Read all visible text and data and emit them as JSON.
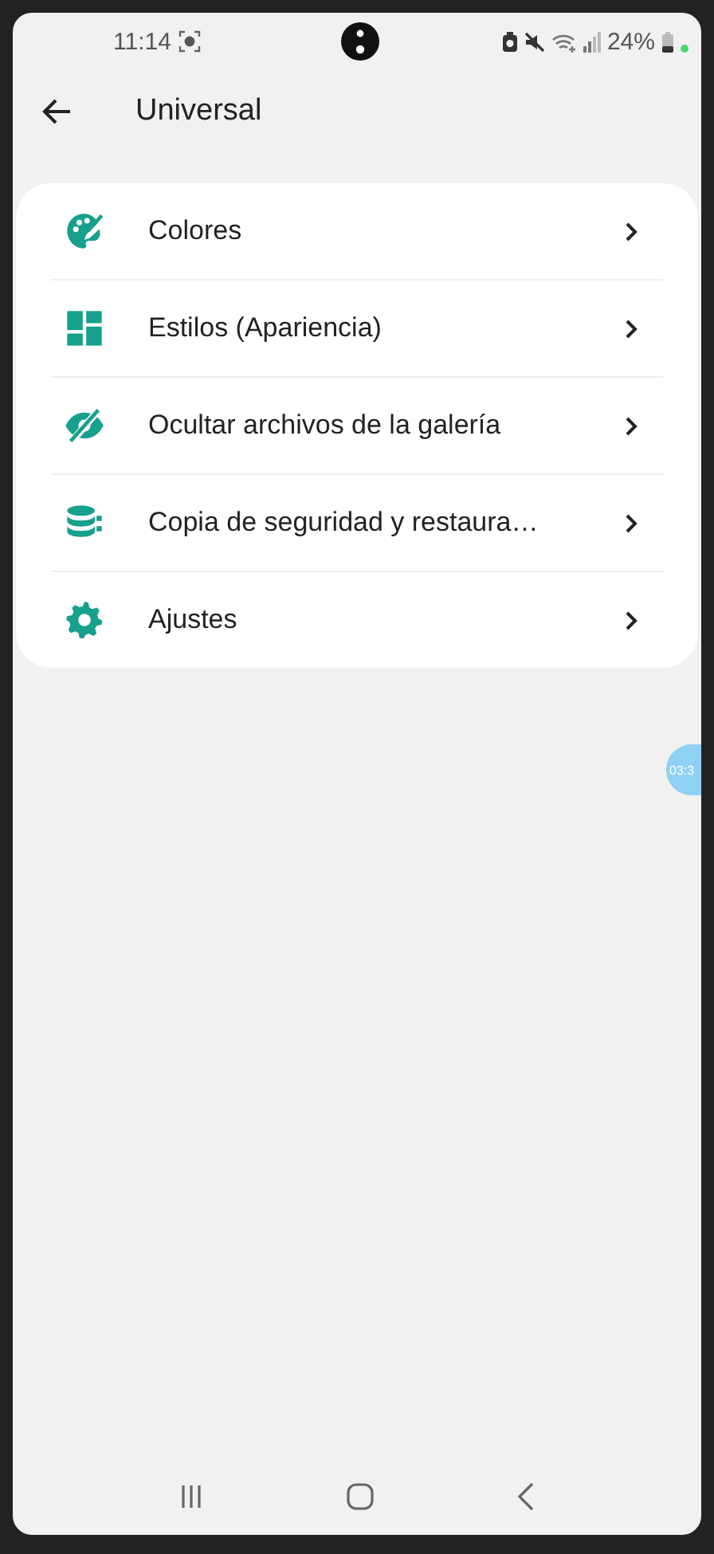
{
  "status_bar": {
    "time": "11:14",
    "battery": "24%"
  },
  "toolbar": {
    "title": "Universal"
  },
  "menu": [
    {
      "kind": "palette",
      "label": "Colores"
    },
    {
      "kind": "dashboard",
      "label": "Estilos (Apariencia)"
    },
    {
      "kind": "eye-off",
      "label": "Ocultar archivos de la galería"
    },
    {
      "kind": "database",
      "label": "Copia de seguridad y restaura…"
    },
    {
      "kind": "gear",
      "label": "Ajustes"
    }
  ],
  "floating_bubble": {
    "text": "03:3"
  }
}
